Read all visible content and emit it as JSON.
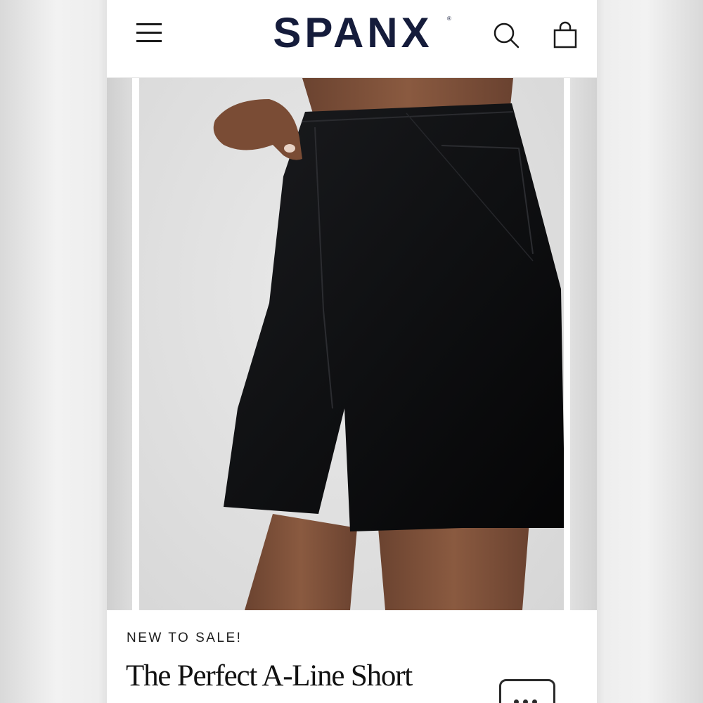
{
  "header": {
    "brand": "SPANX",
    "brand_mark": "®",
    "menu_icon": "hamburger-menu-icon",
    "search_icon": "search-icon",
    "bag_icon": "shopping-bag-icon"
  },
  "product": {
    "image_alt": "Model wearing black A-line shorts",
    "badge": "NEW TO SALE!",
    "title": "The Perfect A-Line Short"
  },
  "chat": {
    "icon": "chat-bubble-icon"
  },
  "colors": {
    "brand": "#151c3b",
    "text": "#111111",
    "background": "#ffffff"
  }
}
